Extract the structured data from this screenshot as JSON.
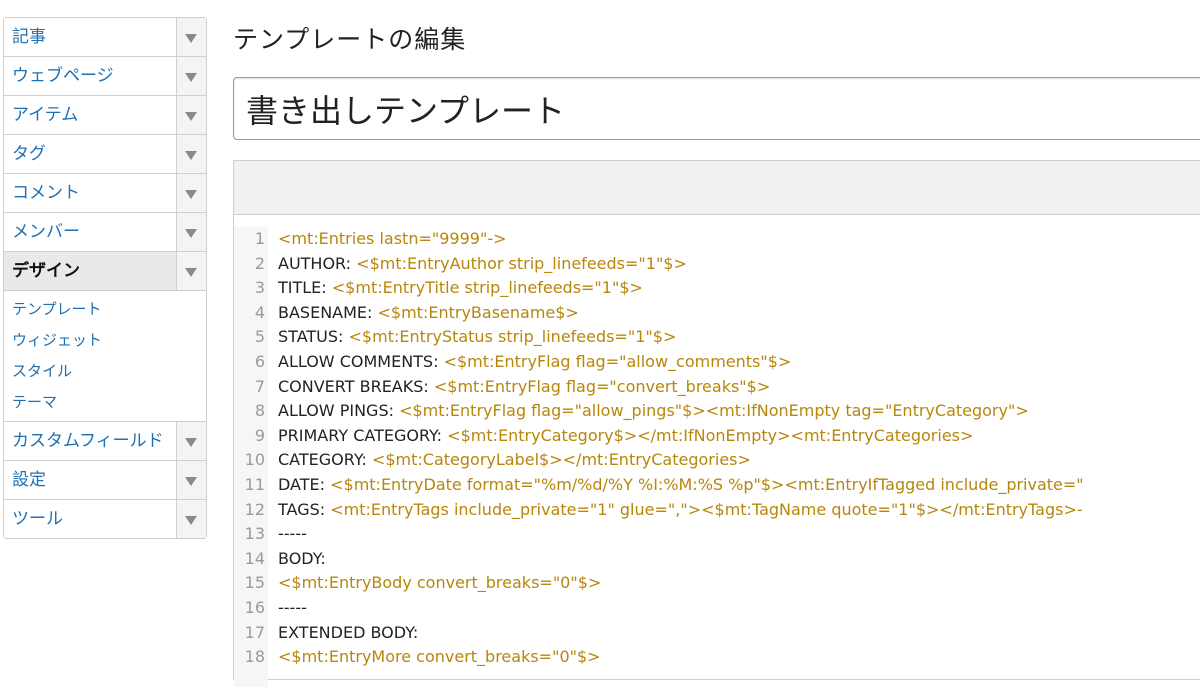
{
  "sidebar": {
    "items": [
      {
        "label": "記事"
      },
      {
        "label": "ウェブページ"
      },
      {
        "label": "アイテム"
      },
      {
        "label": "タグ"
      },
      {
        "label": "コメント"
      },
      {
        "label": "メンバー"
      },
      {
        "label": "デザイン",
        "active": true
      }
    ],
    "design_subitems": [
      {
        "label": "テンプレート"
      },
      {
        "label": "ウィジェット"
      },
      {
        "label": "スタイル"
      },
      {
        "label": "テーマ"
      }
    ],
    "items_after": [
      {
        "label": "カスタムフィールド"
      },
      {
        "label": "設定"
      },
      {
        "label": "ツール"
      }
    ],
    "toggle_icon": "triangle-down-icon"
  },
  "page": {
    "title": "テンプレートの編集",
    "template_name": "書き出しテンプレート"
  },
  "editor": {
    "lines": [
      {
        "n": "1",
        "plain": "",
        "tag": "<mt:Entries lastn=\"9999\"->"
      },
      {
        "n": "2",
        "plain": "AUTHOR: ",
        "tag": "<$mt:EntryAuthor strip_linefeeds=\"1\"$>"
      },
      {
        "n": "3",
        "plain": "TITLE: ",
        "tag": "<$mt:EntryTitle strip_linefeeds=\"1\"$>"
      },
      {
        "n": "4",
        "plain": "BASENAME: ",
        "tag": "<$mt:EntryBasename$>"
      },
      {
        "n": "5",
        "plain": "STATUS: ",
        "tag": "<$mt:EntryStatus strip_linefeeds=\"1\"$>"
      },
      {
        "n": "6",
        "plain": "ALLOW COMMENTS: ",
        "tag": "<$mt:EntryFlag flag=\"allow_comments\"$>"
      },
      {
        "n": "7",
        "plain": "CONVERT BREAKS: ",
        "tag": "<$mt:EntryFlag flag=\"convert_breaks\"$>"
      },
      {
        "n": "8",
        "plain": "ALLOW PINGS: ",
        "tag": "<$mt:EntryFlag flag=\"allow_pings\"$><mt:IfNonEmpty tag=\"EntryCategory\">"
      },
      {
        "n": "9",
        "plain": "PRIMARY CATEGORY: ",
        "tag": "<$mt:EntryCategory$></mt:IfNonEmpty><mt:EntryCategories>"
      },
      {
        "n": "10",
        "plain": "CATEGORY: ",
        "tag": "<$mt:CategoryLabel$></mt:EntryCategories>"
      },
      {
        "n": "11",
        "plain": "DATE: ",
        "tag": "<$mt:EntryDate format=\"%m/%d/%Y %I:%M:%S %p\"$><mt:EntryIfTagged include_private=\""
      },
      {
        "n": "12",
        "plain": "TAGS: ",
        "tag": "<mt:EntryTags include_private=\"1\" glue=\",\"><$mt:TagName quote=\"1\"$></mt:EntryTags>-"
      },
      {
        "n": "13",
        "plain": "-----",
        "tag": ""
      },
      {
        "n": "14",
        "plain": "BODY:",
        "tag": ""
      },
      {
        "n": "15",
        "plain": "",
        "tag": "<$mt:EntryBody convert_breaks=\"0\"$>"
      },
      {
        "n": "16",
        "plain": "-----",
        "tag": ""
      },
      {
        "n": "17",
        "plain": "EXTENDED BODY:",
        "tag": ""
      },
      {
        "n": "18",
        "plain": "",
        "tag": "<$mt:EntryMore convert_breaks=\"0\"$>"
      }
    ]
  },
  "colors": {
    "link": "#1f6fb3",
    "code_tag": "#b8860b",
    "code_text": "#222222",
    "line_number": "#9a9a9a"
  }
}
